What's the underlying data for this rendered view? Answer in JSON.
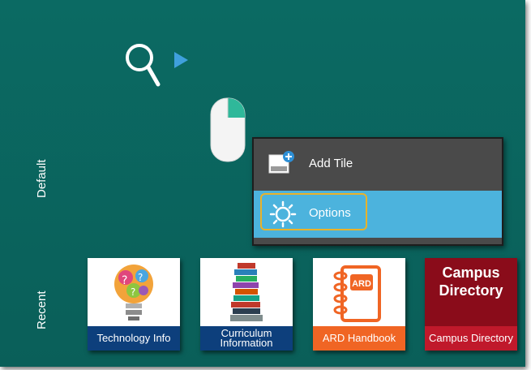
{
  "sections": {
    "default_label": "Default",
    "recent_label": "Recent"
  },
  "context_menu": {
    "add_tile_label": "Add Tile",
    "options_label": "Options"
  },
  "tiles": [
    {
      "caption": "Technology Info",
      "caption_color": "#0d3f7c",
      "icon": "lightbulb-question-icon"
    },
    {
      "caption": "Curriculum Information",
      "caption_color": "#0d3f7c",
      "icon": "books-stack-icon"
    },
    {
      "caption": "ARD Handbook",
      "caption_color": "#f06524",
      "icon": "notebook-icon",
      "icon_text": "ARD"
    },
    {
      "caption": "Campus Directory",
      "caption_color": "#c0192b",
      "title": "Campus Directory",
      "icon": "campus-directory-title"
    }
  ],
  "colors": {
    "background": "#0b6a63",
    "menu": "#4a4a4a",
    "highlight": "#4cb3dd",
    "focus_border": "#e9b22a"
  }
}
